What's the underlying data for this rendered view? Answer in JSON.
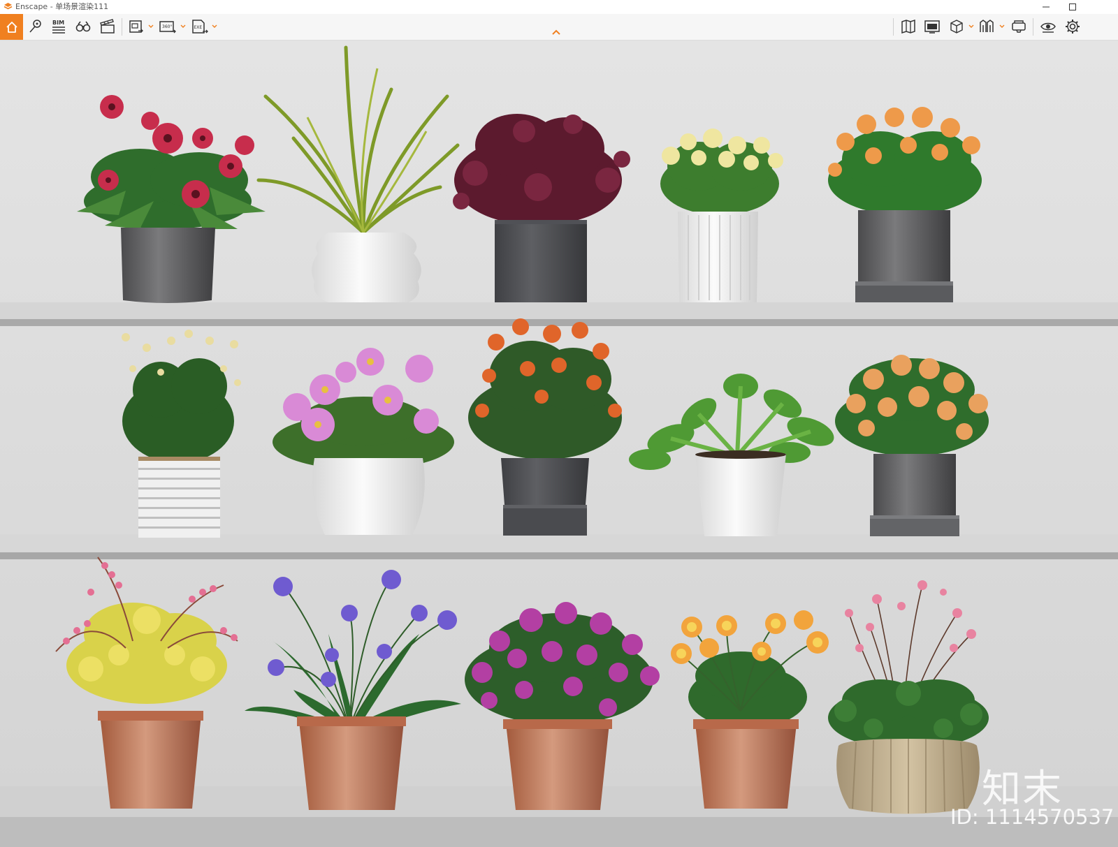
{
  "window": {
    "app_name": "Enscape",
    "title": "Enscape - 单场景渲染111"
  },
  "toolbar": {
    "home_icon": "home-icon",
    "tools_left": [
      {
        "name": "asset-pin-icon"
      },
      {
        "name": "bim-icon",
        "label": "BIM"
      },
      {
        "name": "binoculars-icon"
      },
      {
        "name": "clapperboard-icon"
      }
    ],
    "exports": [
      {
        "name": "screenshot-export-icon"
      },
      {
        "name": "panorama-360-export-icon",
        "label": "360°"
      },
      {
        "name": "exe-export-icon",
        "label": "EXE"
      }
    ],
    "tools_right": [
      {
        "name": "map-icon"
      },
      {
        "name": "render-window-icon"
      },
      {
        "name": "cube-view-icon"
      },
      {
        "name": "library-icon"
      },
      {
        "name": "vr-headset-icon"
      },
      {
        "name": "visual-settings-eye-icon"
      },
      {
        "name": "settings-gear-icon"
      }
    ],
    "collapse_icon": "chevron-up-icon"
  },
  "viewport": {
    "watermark_logo": "知末",
    "watermark_id": "ID: 1114570537",
    "colors": {
      "wall": "#dcdcdc",
      "shelf": "#d2d2d2",
      "shelf_edge": "#9b9b9b"
    }
  }
}
